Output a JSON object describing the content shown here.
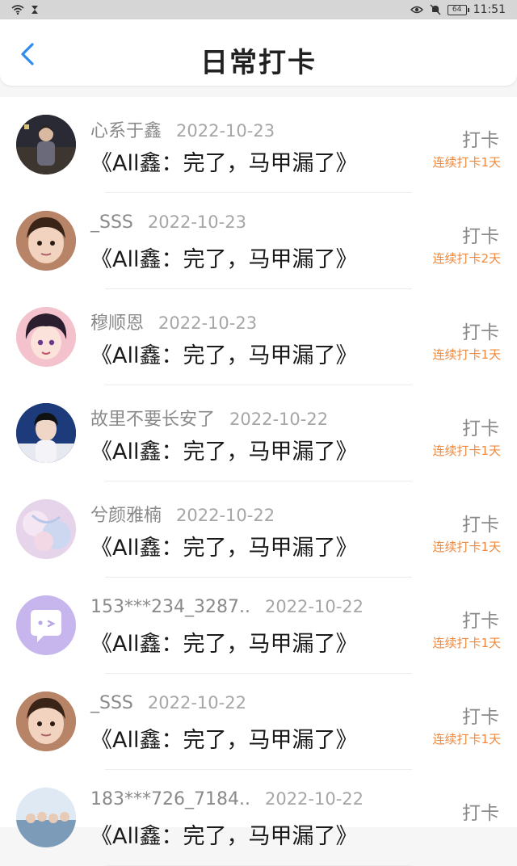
{
  "status_bar": {
    "time": "11:51",
    "battery": "64"
  },
  "header": {
    "title": "日常打卡"
  },
  "colors": {
    "accent": "#2d8cf0",
    "streak": "#f0883d"
  },
  "records": [
    {
      "name": "心系于鑫",
      "date": "2022-10-23",
      "book": "《All鑫：完了，马甲漏了》",
      "action": "打卡",
      "streak": "连续打卡1天",
      "avatar": "photo-avatar-dark"
    },
    {
      "name": "_SSS",
      "date": "2022-10-23",
      "book": "《All鑫：完了，马甲漏了》",
      "action": "打卡",
      "streak": "连续打卡2天",
      "avatar": "photo-avatar-child"
    },
    {
      "name": "穆顺恩",
      "date": "2022-10-23",
      "book": "《All鑫：完了，马甲漏了》",
      "action": "打卡",
      "streak": "连续打卡1天",
      "avatar": "photo-avatar-anime"
    },
    {
      "name": "故里不要长安了",
      "date": "2022-10-22",
      "book": "《All鑫：完了，马甲漏了》",
      "action": "打卡",
      "streak": "连续打卡1天",
      "avatar": "photo-avatar-boy"
    },
    {
      "name": "兮颜雅楠",
      "date": "2022-10-22",
      "book": "《All鑫：完了，马甲漏了》",
      "action": "打卡",
      "streak": "连续打卡1天",
      "avatar": "photo-avatar-pastel"
    },
    {
      "name": "153***234_3287..",
      "date": "2022-10-22",
      "book": "《All鑫：完了，马甲漏了》",
      "action": "打卡",
      "streak": "连续打卡1天",
      "avatar": "default-chat-avatar"
    },
    {
      "name": "_SSS",
      "date": "2022-10-22",
      "book": "《All鑫：完了，马甲漏了》",
      "action": "打卡",
      "streak": "连续打卡1天",
      "avatar": "photo-avatar-child"
    },
    {
      "name": "183***726_7184..",
      "date": "2022-10-22",
      "book": "《All鑫：完了，马甲漏了》",
      "action": "打卡",
      "streak": "",
      "avatar": "photo-avatar-group"
    }
  ]
}
